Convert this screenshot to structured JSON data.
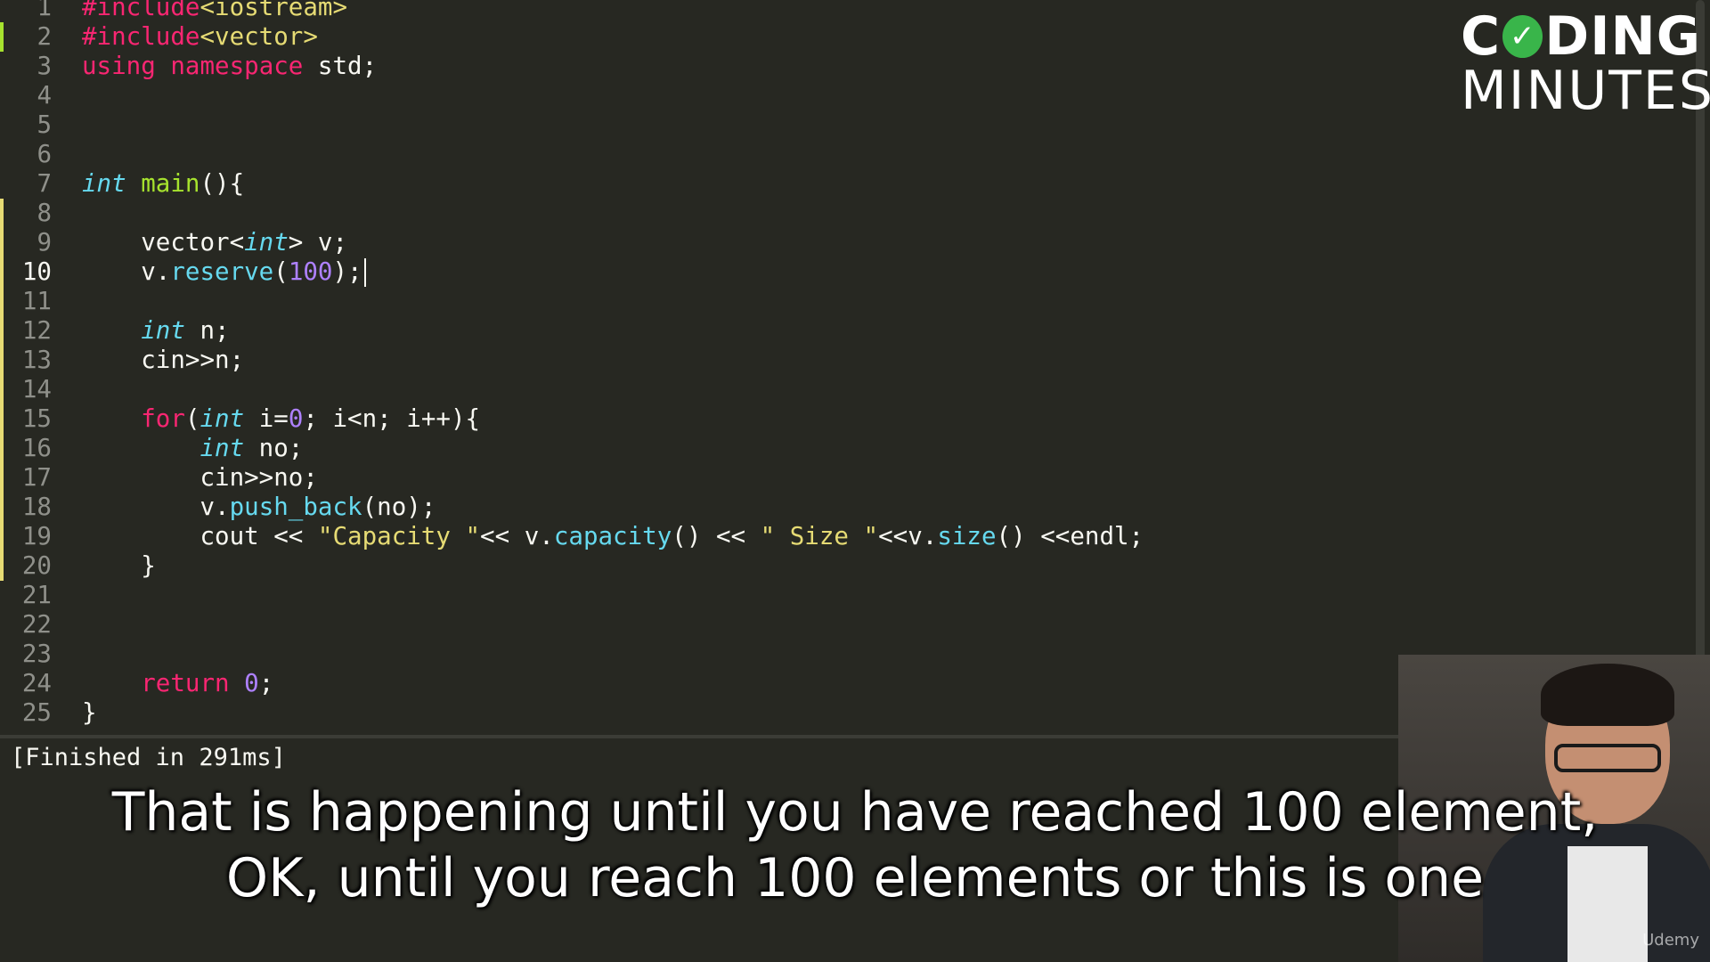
{
  "editor": {
    "active_line": 10,
    "lines": [
      {
        "n": "1",
        "segs": [
          [
            "kw",
            "#include"
          ],
          [
            "str",
            "<iostream>"
          ]
        ]
      },
      {
        "n": "2",
        "segs": [
          [
            "kw",
            "#include"
          ],
          [
            "str",
            "<vector>"
          ]
        ]
      },
      {
        "n": "3",
        "segs": [
          [
            "kw",
            "using"
          ],
          [
            "",
            " "
          ],
          [
            "kw",
            "namespace"
          ],
          [
            "",
            " std;"
          ]
        ]
      },
      {
        "n": "4",
        "segs": []
      },
      {
        "n": "5",
        "segs": []
      },
      {
        "n": "6",
        "segs": []
      },
      {
        "n": "7",
        "segs": [
          [
            "ty",
            "int"
          ],
          [
            "",
            " "
          ],
          [
            "fn",
            "main"
          ],
          [
            "",
            "(){"
          ]
        ]
      },
      {
        "n": "8",
        "segs": []
      },
      {
        "n": "9",
        "segs": [
          [
            "",
            "    vector<"
          ],
          [
            "ty",
            "int"
          ],
          [
            "",
            "> v;"
          ]
        ]
      },
      {
        "n": "10",
        "segs": [
          [
            "",
            "    v."
          ],
          [
            "call",
            "reserve"
          ],
          [
            "",
            "("
          ],
          [
            "num",
            "100"
          ],
          [
            "",
            ");"
          ]
        ]
      },
      {
        "n": "11",
        "segs": []
      },
      {
        "n": "12",
        "segs": [
          [
            "",
            "    "
          ],
          [
            "ty",
            "int"
          ],
          [
            "",
            " n;"
          ]
        ]
      },
      {
        "n": "13",
        "segs": [
          [
            "",
            "    cin>>n;"
          ]
        ]
      },
      {
        "n": "14",
        "segs": []
      },
      {
        "n": "15",
        "segs": [
          [
            "",
            "    "
          ],
          [
            "kw",
            "for"
          ],
          [
            "",
            "("
          ],
          [
            "ty",
            "int"
          ],
          [
            "",
            " i="
          ],
          [
            "num",
            "0"
          ],
          [
            "",
            "; i<n; i++){"
          ]
        ]
      },
      {
        "n": "16",
        "segs": [
          [
            "",
            "        "
          ],
          [
            "ty",
            "int"
          ],
          [
            "",
            " no;"
          ]
        ]
      },
      {
        "n": "17",
        "segs": [
          [
            "",
            "        cin>>no;"
          ]
        ]
      },
      {
        "n": "18",
        "segs": [
          [
            "",
            "        v."
          ],
          [
            "call",
            "push_back"
          ],
          [
            "",
            "(no);"
          ]
        ]
      },
      {
        "n": "19",
        "segs": [
          [
            "",
            "        cout << "
          ],
          [
            "str",
            "\"Capacity \""
          ],
          [
            "",
            "<< v."
          ],
          [
            "call",
            "capacity"
          ],
          [
            "",
            "() << "
          ],
          [
            "str",
            "\" Size \""
          ],
          [
            "",
            "<<v."
          ],
          [
            "call",
            "size"
          ],
          [
            "",
            "() <<endl;"
          ]
        ]
      },
      {
        "n": "20",
        "segs": [
          [
            "",
            "    }"
          ]
        ]
      },
      {
        "n": "21",
        "segs": []
      },
      {
        "n": "22",
        "segs": []
      },
      {
        "n": "23",
        "segs": []
      },
      {
        "n": "24",
        "segs": [
          [
            "",
            "    "
          ],
          [
            "kw",
            "return"
          ],
          [
            "",
            " "
          ],
          [
            "num",
            "0"
          ],
          [
            "",
            ";"
          ]
        ]
      },
      {
        "n": "25",
        "segs": [
          [
            "",
            "}"
          ]
        ]
      }
    ],
    "modified_lines": [
      2,
      8,
      9,
      10,
      11,
      12,
      13,
      14,
      15,
      16,
      17,
      18,
      19,
      20
    ],
    "colors": {
      "background": "#272822",
      "keyword": "#f92672",
      "type": "#66d9ef",
      "function": "#a6e22e",
      "number": "#ae81ff",
      "string": "#e6db74",
      "modified_marker": "#a6e22e",
      "new_marker": "#e6db74"
    }
  },
  "output": {
    "text": "[Finished in 291ms]"
  },
  "caption": {
    "line1": "That is happening until you have reached 100 element,",
    "line2": "OK, until you reach 100 elements or this is one"
  },
  "logo": {
    "top_left": "C",
    "top_right": "DING",
    "check": "✓",
    "bottom": "MINUTES"
  },
  "watermark": "Udemy"
}
